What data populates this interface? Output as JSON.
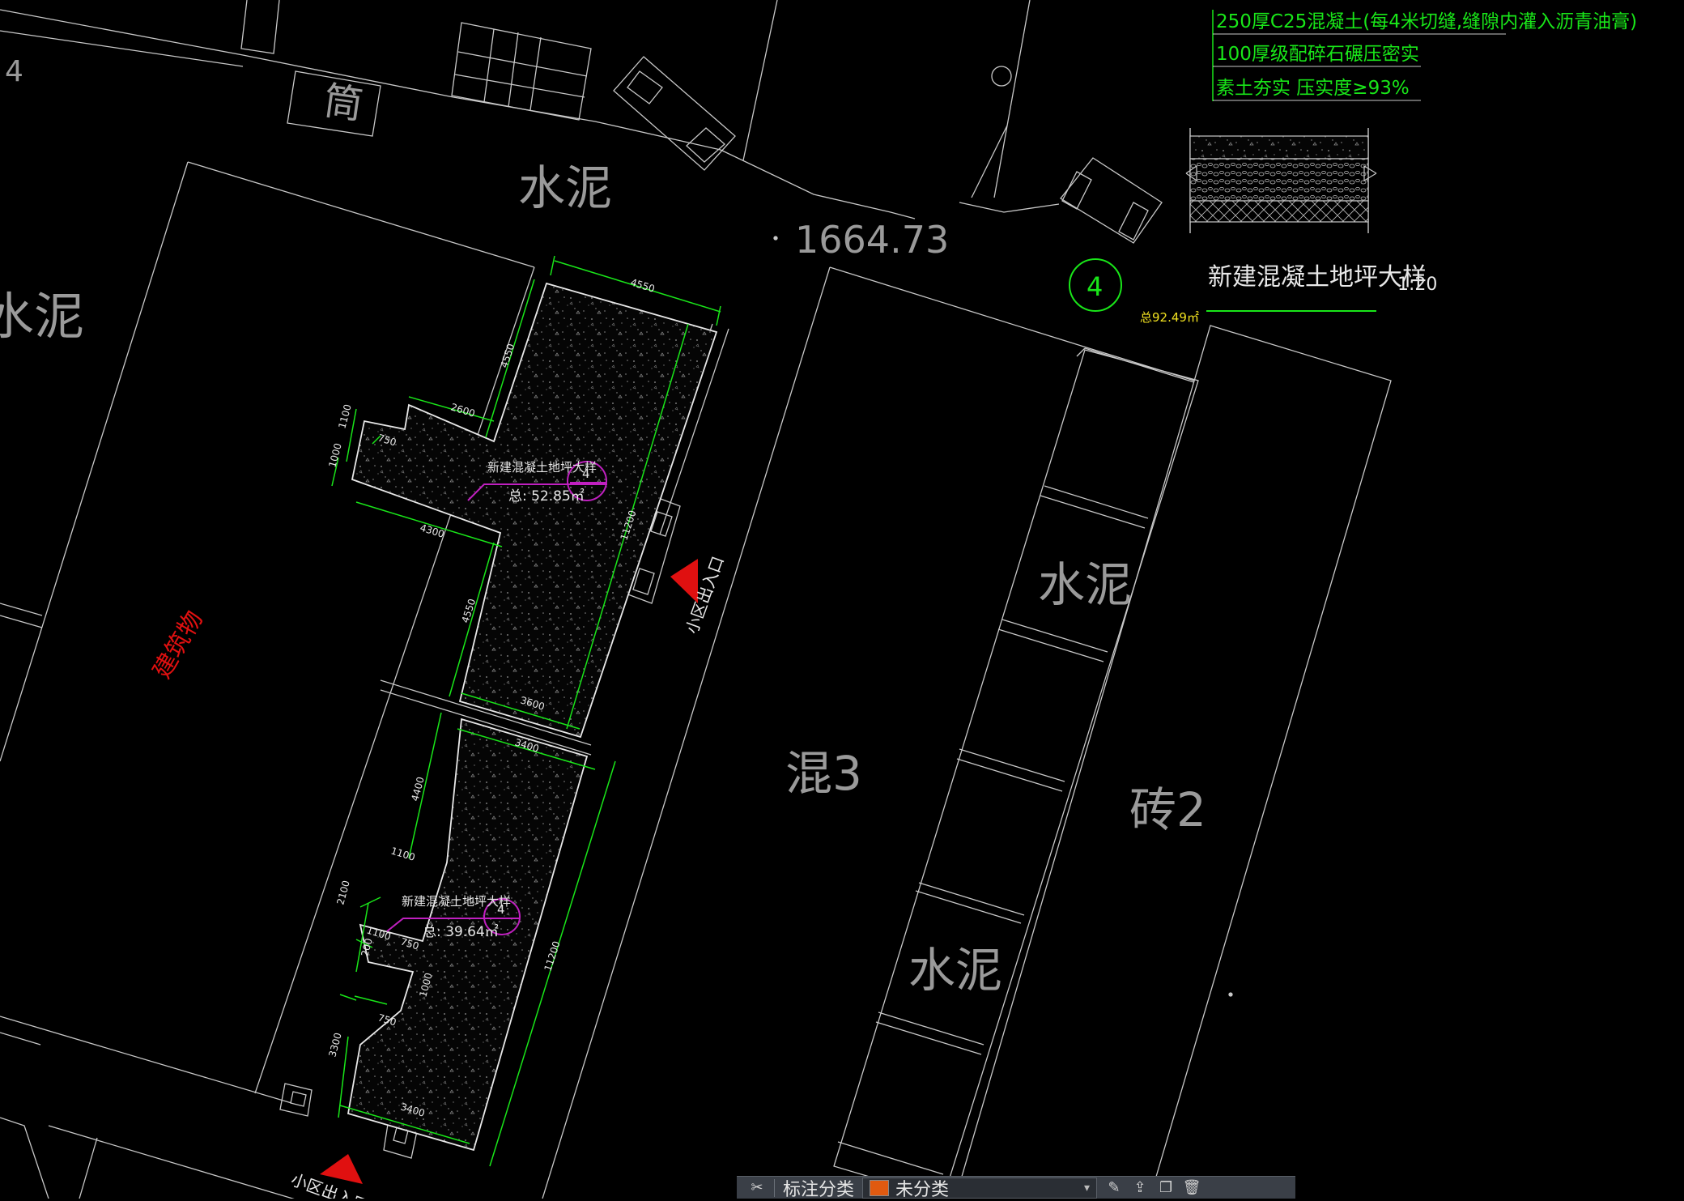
{
  "drawing": {
    "labels": {
      "tong": "筒",
      "shuini_top": "水泥",
      "shuini_left": "水泥",
      "shuini_right1": "水泥",
      "shuini_right2": "水泥",
      "hun3": "混3",
      "zhuan2": "砖2",
      "building": "建筑物",
      "num4_corner": "4",
      "elevation": "1664.73",
      "entrance_right": "小区出入口",
      "entrance_bottom": "小区出入口"
    },
    "detail": {
      "layer1": "250厚C25混凝土(每4米切缝,缝隙内灌入沥青油膏)",
      "layer2": "100厚级配碎石碾压密实",
      "layer3": "素土夯实  压实度≥93%",
      "title": "新建混凝土地坪大样",
      "scale": "1:20",
      "callout_number": "4",
      "total_area": "总92.49㎡"
    },
    "upper_area": {
      "title": "新建混凝土地坪大样",
      "area": "总: 52.85㎡",
      "callout": "4"
    },
    "lower_area": {
      "title": "新建混凝土地坪大样",
      "area": "总: 39.64㎡",
      "callout": "4"
    },
    "dimensions": {
      "d4550a": "4550",
      "d4550b": "4550",
      "d2600": "2600",
      "d1100a": "1100",
      "d750a": "750",
      "d1000a": "1000",
      "d4300": "4300",
      "d4550c": "4550",
      "d11200a": "11200",
      "d3600": "3600",
      "d3400a": "3400",
      "d4400": "4400",
      "d1100b": "1100",
      "d2100": "2100",
      "d1100c": "1100",
      "d200": "200",
      "d750b": "750",
      "d1000b": "1000",
      "d750c": "750",
      "d3300": "3300",
      "d3400b": "3400",
      "d11200b": "11200"
    }
  },
  "toolbar": {
    "category_label": "标注分类",
    "layer_value": "未分类"
  },
  "colors": {
    "background": "#000000",
    "linework": "#c8c8c8",
    "green": "#19e619",
    "magenta": "#c020c0",
    "red": "#e01010",
    "yellow": "#f0e020",
    "swatch": "#e05a10"
  }
}
